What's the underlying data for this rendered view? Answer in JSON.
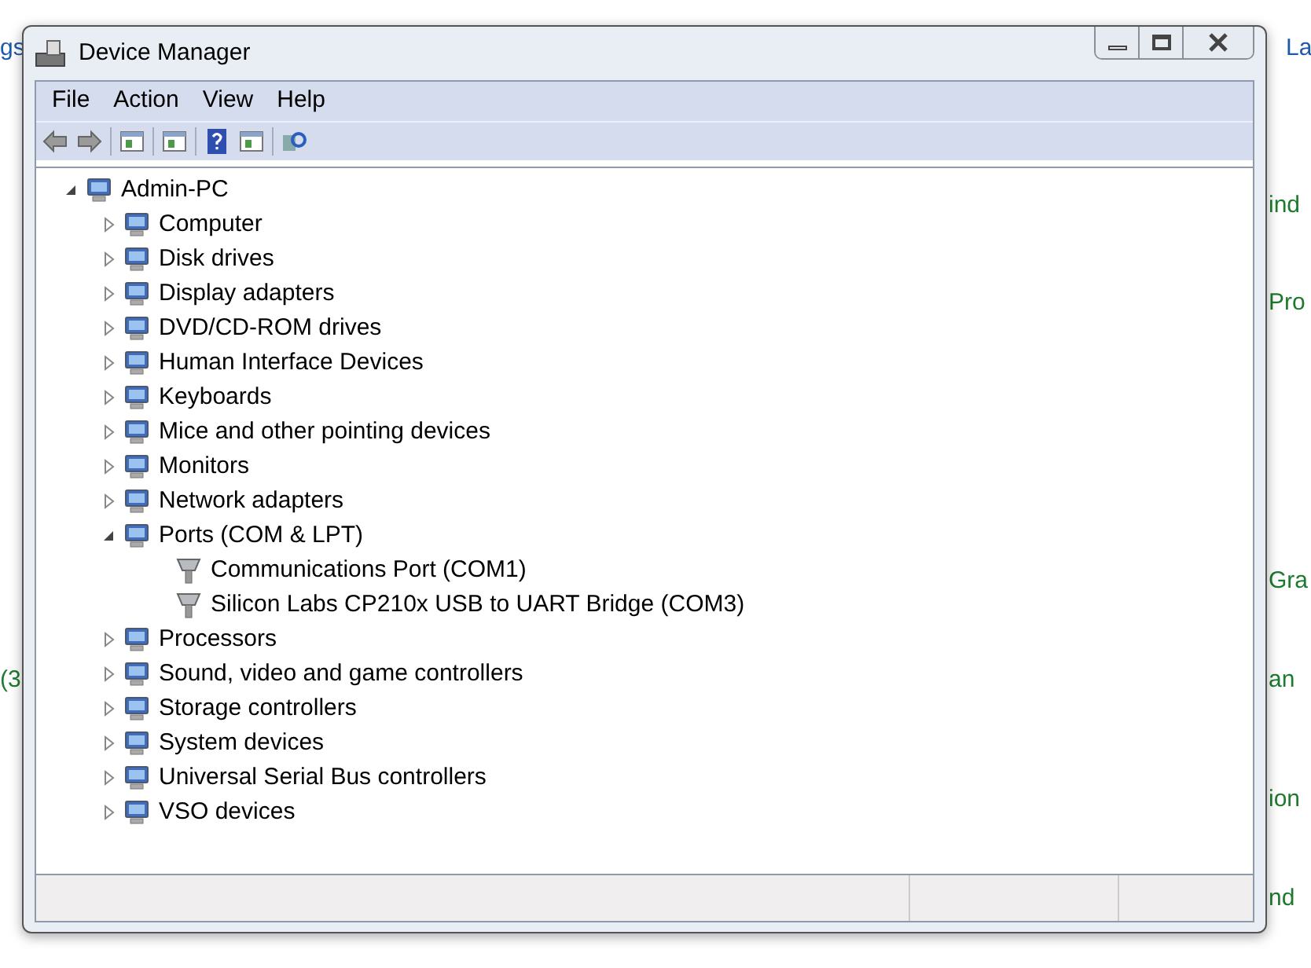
{
  "background_texts": [
    {
      "text": "gs",
      "kind": "link"
    },
    {
      "text": "La",
      "kind": "link"
    },
    {
      "text": "ind",
      "kind": "heading"
    },
    {
      "text": "Pro",
      "kind": "heading"
    },
    {
      "text": "Gra",
      "kind": "heading"
    },
    {
      "text": "(3",
      "kind": "heading"
    },
    {
      "text": "an",
      "kind": "heading"
    },
    {
      "text": "ion",
      "kind": "heading"
    },
    {
      "text": "nd",
      "kind": "heading"
    }
  ],
  "window": {
    "title": "Device Manager"
  },
  "menu": [
    "File",
    "Action",
    "View",
    "Help"
  ],
  "tree": {
    "label": "Admin-PC",
    "expanded": true,
    "children": [
      {
        "label": "Computer",
        "expanded": false
      },
      {
        "label": "Disk drives",
        "expanded": false
      },
      {
        "label": "Display adapters",
        "expanded": false
      },
      {
        "label": "DVD/CD-ROM drives",
        "expanded": false
      },
      {
        "label": "Human Interface Devices",
        "expanded": false
      },
      {
        "label": "Keyboards",
        "expanded": false
      },
      {
        "label": "Mice and other pointing devices",
        "expanded": false
      },
      {
        "label": "Monitors",
        "expanded": false
      },
      {
        "label": "Network adapters",
        "expanded": false
      },
      {
        "label": "Ports (COM & LPT)",
        "expanded": true,
        "children": [
          {
            "label": "Communications Port (COM1)"
          },
          {
            "label": "Silicon Labs CP210x USB to UART Bridge (COM3)"
          }
        ]
      },
      {
        "label": "Processors",
        "expanded": false
      },
      {
        "label": "Sound, video and game controllers",
        "expanded": false
      },
      {
        "label": "Storage controllers",
        "expanded": false
      },
      {
        "label": "System devices",
        "expanded": false
      },
      {
        "label": "Universal Serial Bus controllers",
        "expanded": false
      },
      {
        "label": "VSO devices",
        "expanded": false
      }
    ]
  }
}
